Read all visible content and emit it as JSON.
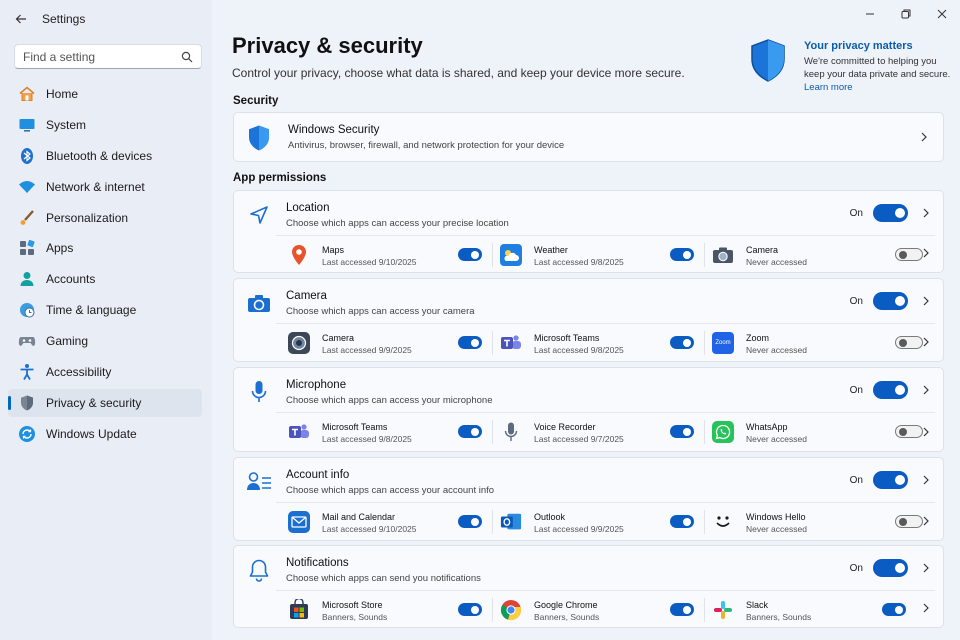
{
  "window": {
    "app_title": "Settings",
    "icons": {
      "back": "back-arrow-icon",
      "minimize": "minimize-icon",
      "restore": "restore-icon",
      "close": "close-icon"
    }
  },
  "search": {
    "placeholder": "Find a setting",
    "value": ""
  },
  "sidebar": {
    "items": [
      {
        "label": "Home",
        "icon": "home-icon",
        "active": false
      },
      {
        "label": "System",
        "icon": "monitor-icon",
        "active": false
      },
      {
        "label": "Bluetooth & devices",
        "icon": "bluetooth-icon",
        "active": false
      },
      {
        "label": "Network & internet",
        "icon": "wifi-icon",
        "active": false
      },
      {
        "label": "Personalization",
        "icon": "brush-icon",
        "active": false
      },
      {
        "label": "Apps",
        "icon": "apps-icon",
        "active": false
      },
      {
        "label": "Accounts",
        "icon": "person-icon",
        "active": false
      },
      {
        "label": "Time & language",
        "icon": "globe-clock-icon",
        "active": false
      },
      {
        "label": "Gaming",
        "icon": "gamepad-icon",
        "active": false
      },
      {
        "label": "Accessibility",
        "icon": "accessibility-icon",
        "active": false
      },
      {
        "label": "Privacy & security",
        "icon": "shield-icon",
        "active": true
      },
      {
        "label": "Windows Update",
        "icon": "update-icon",
        "active": false
      }
    ]
  },
  "header": {
    "title": "Privacy & security",
    "description": "Control your privacy, choose what data is shared, and keep your device more secure."
  },
  "privacy_card": {
    "title": "Your privacy matters",
    "text": "We're committed to helping you keep your data private and secure.",
    "link": "Learn more"
  },
  "security": {
    "heading": "Security",
    "item": {
      "title": "Windows Security",
      "subtitle": "Antivirus, browser, firewall, and network protection for your device"
    }
  },
  "permissions": {
    "heading": "App permissions",
    "items": [
      {
        "title": "Location",
        "subtitle": "Choose which apps can access your precise location",
        "state": "On",
        "on": true,
        "apps": [
          {
            "name": "Maps",
            "status": "Last accessed 9/10/2025",
            "on": true
          },
          {
            "name": "Weather",
            "status": "Last accessed 9/8/2025",
            "on": true
          },
          {
            "name": "Camera",
            "status": "Never accessed",
            "on": false
          }
        ]
      },
      {
        "title": "Camera",
        "subtitle": "Choose which apps can access your camera",
        "state": "On",
        "on": true,
        "apps": [
          {
            "name": "Camera",
            "status": "Last accessed 9/9/2025",
            "on": true
          },
          {
            "name": "Microsoft Teams",
            "status": "Last accessed 9/8/2025",
            "on": true
          },
          {
            "name": "Zoom",
            "status": "Never accessed",
            "on": false,
            "icon_text": "Zoom"
          }
        ]
      },
      {
        "title": "Microphone",
        "subtitle": "Choose which apps can access your microphone",
        "state": "On",
        "on": true,
        "apps": [
          {
            "name": "Microsoft Teams",
            "status": "Last accessed 9/8/2025",
            "on": true
          },
          {
            "name": "Voice Recorder",
            "status": "Last accessed 9/7/2025",
            "on": true
          },
          {
            "name": "WhatsApp",
            "status": "Never accessed",
            "on": false
          }
        ]
      },
      {
        "title": "Account info",
        "subtitle": "Choose which apps can access your account info",
        "state": "On",
        "on": true,
        "apps": [
          {
            "name": "Mail and Calendar",
            "status": "Last accessed 9/10/2025",
            "on": true
          },
          {
            "name": "Outlook",
            "status": "Last accessed 9/9/2025",
            "on": true
          },
          {
            "name": "Windows Hello",
            "status": "Never accessed",
            "on": false
          }
        ]
      },
      {
        "title": "Notifications",
        "subtitle": "Choose which apps can send you notifications",
        "state": "On",
        "on": true,
        "apps": [
          {
            "name": "Microsoft Store",
            "status": "Banners, Sounds",
            "on": true
          },
          {
            "name": "Google Chrome",
            "status": "Banners, Sounds",
            "on": true
          },
          {
            "name": "Slack",
            "status": "Banners, Sounds",
            "on": true
          }
        ]
      }
    ]
  },
  "colors": {
    "accent": "#0a5cc2",
    "link": "#0b5cad",
    "background": "#eef2f9",
    "card": "#f8fafd"
  }
}
